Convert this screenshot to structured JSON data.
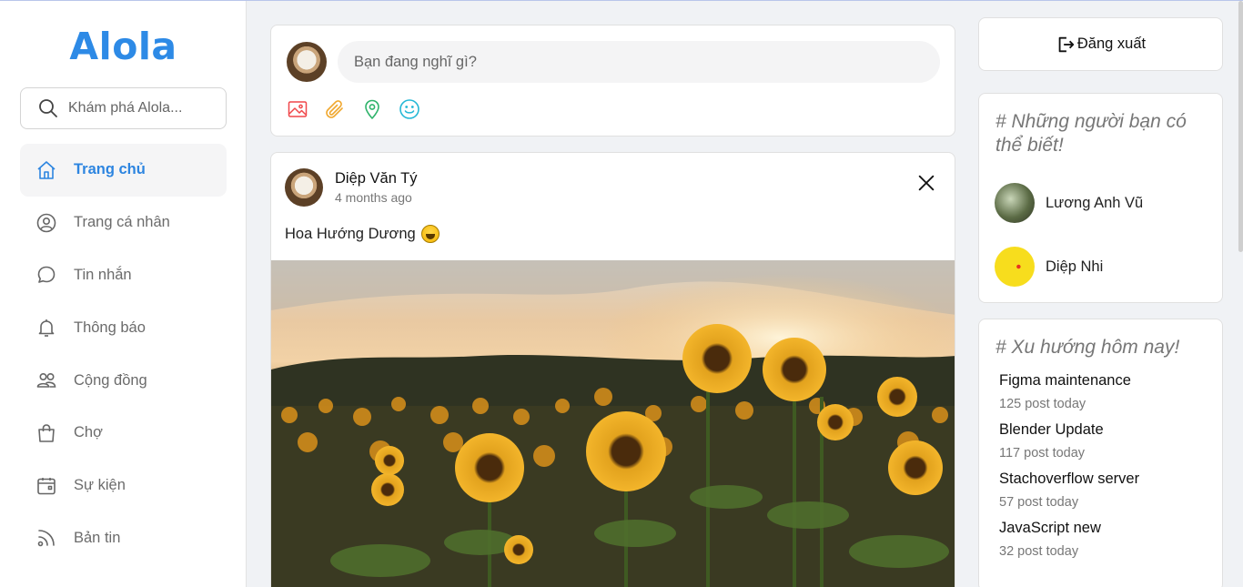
{
  "sidebar": {
    "logo": "Alola",
    "search_placeholder": "Khám phá Alola...",
    "items": [
      {
        "label": "Trang chủ",
        "icon": "home-icon",
        "active": true
      },
      {
        "label": "Trang cá nhân",
        "icon": "user-circle-icon"
      },
      {
        "label": "Tin nhắn",
        "icon": "message-icon"
      },
      {
        "label": "Thông báo",
        "icon": "bell-icon"
      },
      {
        "label": "Cộng đồng",
        "icon": "users-icon"
      },
      {
        "label": "Chợ",
        "icon": "shopping-bag-icon"
      },
      {
        "label": "Sự kiện",
        "icon": "calendar-icon"
      },
      {
        "label": "Bản tin",
        "icon": "rss-icon"
      }
    ]
  },
  "composer": {
    "placeholder": "Bạn đang nghĩ gì?",
    "tools": [
      "image-icon",
      "attachment-icon",
      "location-icon",
      "emoji-icon"
    ]
  },
  "post": {
    "author": "Diệp Văn Tý",
    "time": "4 months ago",
    "text": "Hoa Hướng Dương"
  },
  "right": {
    "logout_label": "Đăng xuất",
    "friends_title": "# Những người bạn có thể biết!",
    "friends": [
      {
        "name": "Lương Anh Vũ"
      },
      {
        "name": "Diệp Nhi"
      }
    ],
    "trends_title": "# Xu hướng hôm nay!",
    "trends": [
      {
        "name": "Figma maintenance",
        "count": "125 post today"
      },
      {
        "name": "Blender Update",
        "count": "117 post today"
      },
      {
        "name": "Stachoverflow server",
        "count": "57 post today"
      },
      {
        "name": "JavaScript new",
        "count": "32 post today"
      }
    ]
  },
  "colors": {
    "brand": "#2d8ae6",
    "active_nav": "#2d85e0",
    "image_tool": "#f0474a",
    "attach_tool": "#f0a830",
    "location_tool": "#2fb36b",
    "emoji_tool": "#25b8d6"
  }
}
